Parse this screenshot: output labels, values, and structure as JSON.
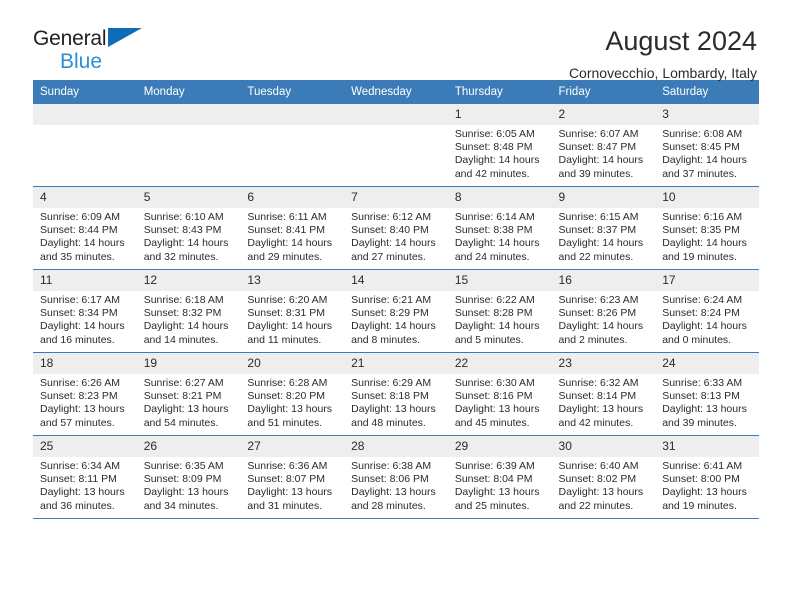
{
  "logo": {
    "line1": "General",
    "line2": "Blue",
    "triangle_color": "#0f6cb5",
    "line2_color": "#2b8fd4"
  },
  "header": {
    "title": "August 2024",
    "subtitle": "Cornovecchio, Lombardy, Italy"
  },
  "theme": {
    "header_bar": "#3b7cb8",
    "daynum_band": "#eeeeee",
    "text": "#2b2b2b"
  },
  "weekdays": [
    "Sunday",
    "Monday",
    "Tuesday",
    "Wednesday",
    "Thursday",
    "Friday",
    "Saturday"
  ],
  "weeks": [
    [
      {
        "day": "",
        "sunrise": "",
        "sunset": "",
        "daylight_1": "",
        "daylight_2": ""
      },
      {
        "day": "",
        "sunrise": "",
        "sunset": "",
        "daylight_1": "",
        "daylight_2": ""
      },
      {
        "day": "",
        "sunrise": "",
        "sunset": "",
        "daylight_1": "",
        "daylight_2": ""
      },
      {
        "day": "",
        "sunrise": "",
        "sunset": "",
        "daylight_1": "",
        "daylight_2": ""
      },
      {
        "day": "1",
        "sunrise": "Sunrise: 6:05 AM",
        "sunset": "Sunset: 8:48 PM",
        "daylight_1": "Daylight: 14 hours",
        "daylight_2": "and 42 minutes."
      },
      {
        "day": "2",
        "sunrise": "Sunrise: 6:07 AM",
        "sunset": "Sunset: 8:47 PM",
        "daylight_1": "Daylight: 14 hours",
        "daylight_2": "and 39 minutes."
      },
      {
        "day": "3",
        "sunrise": "Sunrise: 6:08 AM",
        "sunset": "Sunset: 8:45 PM",
        "daylight_1": "Daylight: 14 hours",
        "daylight_2": "and 37 minutes."
      }
    ],
    [
      {
        "day": "4",
        "sunrise": "Sunrise: 6:09 AM",
        "sunset": "Sunset: 8:44 PM",
        "daylight_1": "Daylight: 14 hours",
        "daylight_2": "and 35 minutes."
      },
      {
        "day": "5",
        "sunrise": "Sunrise: 6:10 AM",
        "sunset": "Sunset: 8:43 PM",
        "daylight_1": "Daylight: 14 hours",
        "daylight_2": "and 32 minutes."
      },
      {
        "day": "6",
        "sunrise": "Sunrise: 6:11 AM",
        "sunset": "Sunset: 8:41 PM",
        "daylight_1": "Daylight: 14 hours",
        "daylight_2": "and 29 minutes."
      },
      {
        "day": "7",
        "sunrise": "Sunrise: 6:12 AM",
        "sunset": "Sunset: 8:40 PM",
        "daylight_1": "Daylight: 14 hours",
        "daylight_2": "and 27 minutes."
      },
      {
        "day": "8",
        "sunrise": "Sunrise: 6:14 AM",
        "sunset": "Sunset: 8:38 PM",
        "daylight_1": "Daylight: 14 hours",
        "daylight_2": "and 24 minutes."
      },
      {
        "day": "9",
        "sunrise": "Sunrise: 6:15 AM",
        "sunset": "Sunset: 8:37 PM",
        "daylight_1": "Daylight: 14 hours",
        "daylight_2": "and 22 minutes."
      },
      {
        "day": "10",
        "sunrise": "Sunrise: 6:16 AM",
        "sunset": "Sunset: 8:35 PM",
        "daylight_1": "Daylight: 14 hours",
        "daylight_2": "and 19 minutes."
      }
    ],
    [
      {
        "day": "11",
        "sunrise": "Sunrise: 6:17 AM",
        "sunset": "Sunset: 8:34 PM",
        "daylight_1": "Daylight: 14 hours",
        "daylight_2": "and 16 minutes."
      },
      {
        "day": "12",
        "sunrise": "Sunrise: 6:18 AM",
        "sunset": "Sunset: 8:32 PM",
        "daylight_1": "Daylight: 14 hours",
        "daylight_2": "and 14 minutes."
      },
      {
        "day": "13",
        "sunrise": "Sunrise: 6:20 AM",
        "sunset": "Sunset: 8:31 PM",
        "daylight_1": "Daylight: 14 hours",
        "daylight_2": "and 11 minutes."
      },
      {
        "day": "14",
        "sunrise": "Sunrise: 6:21 AM",
        "sunset": "Sunset: 8:29 PM",
        "daylight_1": "Daylight: 14 hours",
        "daylight_2": "and 8 minutes."
      },
      {
        "day": "15",
        "sunrise": "Sunrise: 6:22 AM",
        "sunset": "Sunset: 8:28 PM",
        "daylight_1": "Daylight: 14 hours",
        "daylight_2": "and 5 minutes."
      },
      {
        "day": "16",
        "sunrise": "Sunrise: 6:23 AM",
        "sunset": "Sunset: 8:26 PM",
        "daylight_1": "Daylight: 14 hours",
        "daylight_2": "and 2 minutes."
      },
      {
        "day": "17",
        "sunrise": "Sunrise: 6:24 AM",
        "sunset": "Sunset: 8:24 PM",
        "daylight_1": "Daylight: 14 hours",
        "daylight_2": "and 0 minutes."
      }
    ],
    [
      {
        "day": "18",
        "sunrise": "Sunrise: 6:26 AM",
        "sunset": "Sunset: 8:23 PM",
        "daylight_1": "Daylight: 13 hours",
        "daylight_2": "and 57 minutes."
      },
      {
        "day": "19",
        "sunrise": "Sunrise: 6:27 AM",
        "sunset": "Sunset: 8:21 PM",
        "daylight_1": "Daylight: 13 hours",
        "daylight_2": "and 54 minutes."
      },
      {
        "day": "20",
        "sunrise": "Sunrise: 6:28 AM",
        "sunset": "Sunset: 8:20 PM",
        "daylight_1": "Daylight: 13 hours",
        "daylight_2": "and 51 minutes."
      },
      {
        "day": "21",
        "sunrise": "Sunrise: 6:29 AM",
        "sunset": "Sunset: 8:18 PM",
        "daylight_1": "Daylight: 13 hours",
        "daylight_2": "and 48 minutes."
      },
      {
        "day": "22",
        "sunrise": "Sunrise: 6:30 AM",
        "sunset": "Sunset: 8:16 PM",
        "daylight_1": "Daylight: 13 hours",
        "daylight_2": "and 45 minutes."
      },
      {
        "day": "23",
        "sunrise": "Sunrise: 6:32 AM",
        "sunset": "Sunset: 8:14 PM",
        "daylight_1": "Daylight: 13 hours",
        "daylight_2": "and 42 minutes."
      },
      {
        "day": "24",
        "sunrise": "Sunrise: 6:33 AM",
        "sunset": "Sunset: 8:13 PM",
        "daylight_1": "Daylight: 13 hours",
        "daylight_2": "and 39 minutes."
      }
    ],
    [
      {
        "day": "25",
        "sunrise": "Sunrise: 6:34 AM",
        "sunset": "Sunset: 8:11 PM",
        "daylight_1": "Daylight: 13 hours",
        "daylight_2": "and 36 minutes."
      },
      {
        "day": "26",
        "sunrise": "Sunrise: 6:35 AM",
        "sunset": "Sunset: 8:09 PM",
        "daylight_1": "Daylight: 13 hours",
        "daylight_2": "and 34 minutes."
      },
      {
        "day": "27",
        "sunrise": "Sunrise: 6:36 AM",
        "sunset": "Sunset: 8:07 PM",
        "daylight_1": "Daylight: 13 hours",
        "daylight_2": "and 31 minutes."
      },
      {
        "day": "28",
        "sunrise": "Sunrise: 6:38 AM",
        "sunset": "Sunset: 8:06 PM",
        "daylight_1": "Daylight: 13 hours",
        "daylight_2": "and 28 minutes."
      },
      {
        "day": "29",
        "sunrise": "Sunrise: 6:39 AM",
        "sunset": "Sunset: 8:04 PM",
        "daylight_1": "Daylight: 13 hours",
        "daylight_2": "and 25 minutes."
      },
      {
        "day": "30",
        "sunrise": "Sunrise: 6:40 AM",
        "sunset": "Sunset: 8:02 PM",
        "daylight_1": "Daylight: 13 hours",
        "daylight_2": "and 22 minutes."
      },
      {
        "day": "31",
        "sunrise": "Sunrise: 6:41 AM",
        "sunset": "Sunset: 8:00 PM",
        "daylight_1": "Daylight: 13 hours",
        "daylight_2": "and 19 minutes."
      }
    ]
  ]
}
